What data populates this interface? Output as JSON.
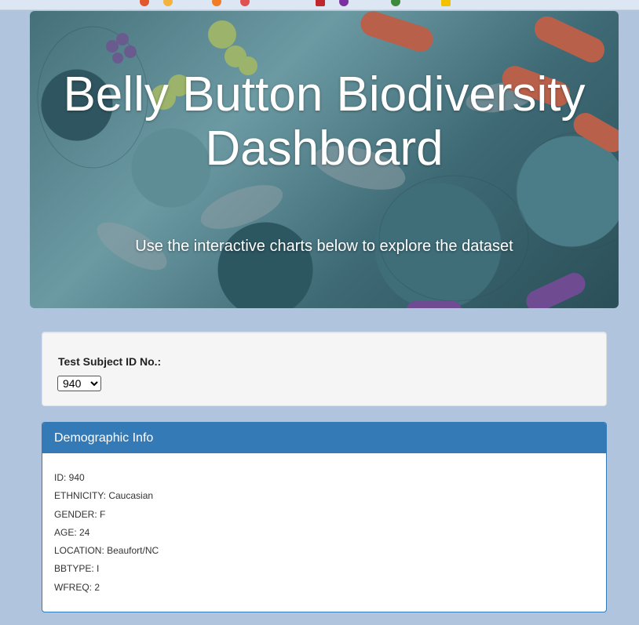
{
  "hero": {
    "title": "Belly Button Biodiversity Dashboard",
    "subtitle": "Use the interactive charts below to explore the dataset"
  },
  "selector": {
    "label": "Test Subject ID No.:",
    "selected": "940"
  },
  "demographics": {
    "heading": "Demographic Info",
    "lines": [
      "ID: 940",
      "ETHNICITY: Caucasian",
      "GENDER: F",
      "AGE: 24",
      "LOCATION: Beaufort/NC",
      "BBTYPE: I",
      "WFREQ: 2"
    ]
  },
  "colors": {
    "page_bg": "#b0c4de",
    "panel_primary": "#337ab7",
    "well_bg": "#f5f5f5"
  }
}
